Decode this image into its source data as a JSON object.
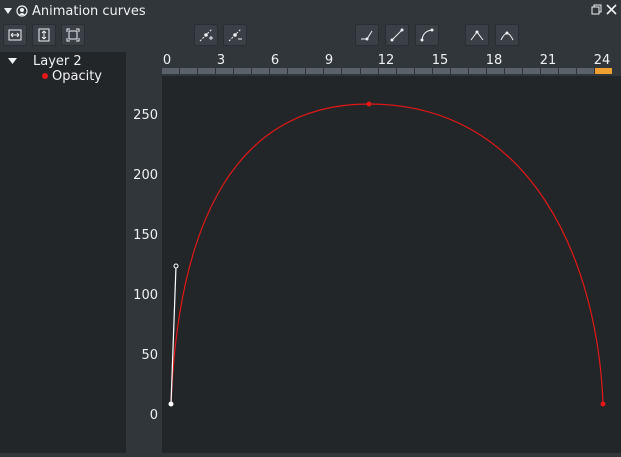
{
  "panel": {
    "title": "Animation curves"
  },
  "tree": {
    "layer": "Layer 2",
    "property": "Opacity"
  },
  "timeline": {
    "frame_ticks": [
      "0",
      "3",
      "6",
      "9",
      "12",
      "15",
      "18",
      "21",
      "24"
    ],
    "frame_count": 25,
    "current_frame": 24
  },
  "value_axis": {
    "ticks": [
      "250",
      "200",
      "150",
      "100",
      "50",
      "0"
    ]
  },
  "chart_data": {
    "type": "line",
    "x_label": "",
    "y_label": "",
    "xlim": [
      0,
      24
    ],
    "ylim": [
      0,
      250
    ],
    "series": [
      {
        "color": "#e31717",
        "keyframes": [
          {
            "x": 0,
            "y": 5
          },
          {
            "x": 11,
            "y": 255
          },
          {
            "x": 24,
            "y": 5
          }
        ]
      }
    ],
    "selected_keyframe": {
      "x": 0,
      "y": 5,
      "handle_y": 120
    }
  },
  "colors": {
    "curve": "#e31717",
    "current_frame": "#f0a030",
    "background": "#232629"
  },
  "icons": {
    "toolbar": [
      "fit-horizontal-icon",
      "fit-vertical-icon",
      "zoom-fit-icon",
      "add-keyframe-icon",
      "remove-keyframe-icon",
      "linear-left-interpolation-icon",
      "linear-interpolation-icon",
      "smooth-interpolation-icon",
      "sharp-tangent-icon",
      "smooth-tangent-icon"
    ]
  }
}
